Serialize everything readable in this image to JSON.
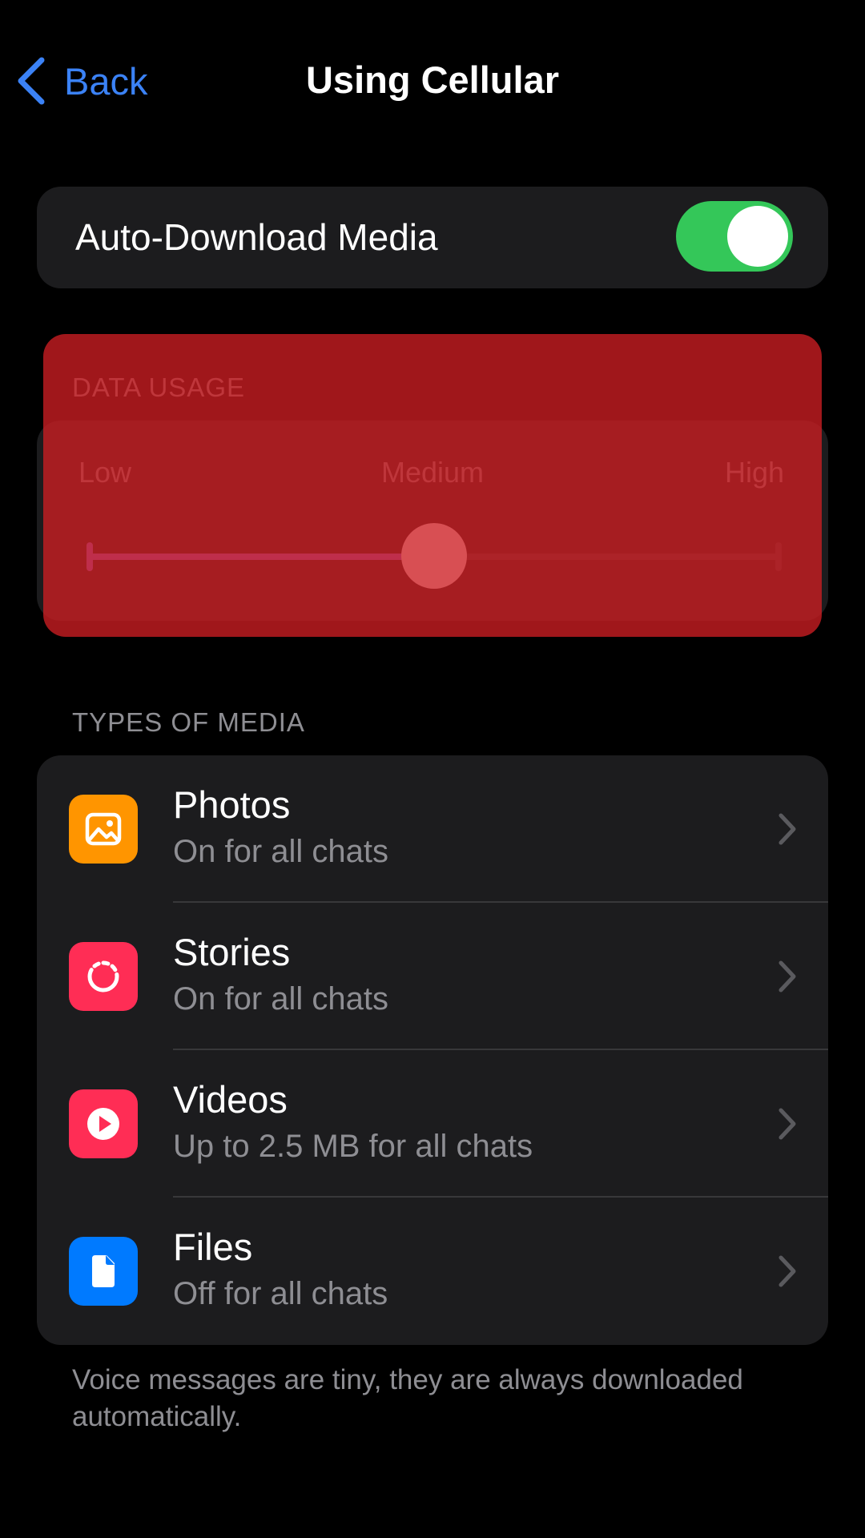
{
  "nav": {
    "back_label": "Back",
    "title": "Using Cellular",
    "accent_color": "#3b82f6"
  },
  "auto_download": {
    "label": "Auto-Download Media",
    "enabled": true,
    "switch_color": "#34c759"
  },
  "data_usage": {
    "header": "DATA USAGE",
    "levels": [
      "Low",
      "Medium",
      "High"
    ],
    "selected": "Medium",
    "value_fraction": 0.5
  },
  "media": {
    "header": "TYPES OF MEDIA",
    "items": [
      {
        "title": "Photos",
        "subtitle": "On for all chats",
        "icon": "photo-icon",
        "color": "#ff9500"
      },
      {
        "title": "Stories",
        "subtitle": "On for all chats",
        "icon": "stories-icon",
        "color": "#ff2d55"
      },
      {
        "title": "Videos",
        "subtitle": "Up to 2.5 MB for all chats",
        "icon": "video-play-icon",
        "color": "#ff2d55"
      },
      {
        "title": "Files",
        "subtitle": "Off for all chats",
        "icon": "file-icon",
        "color": "#007aff"
      }
    ]
  },
  "footer": {
    "note": "Voice messages are tiny, they are always downloaded automatically."
  }
}
